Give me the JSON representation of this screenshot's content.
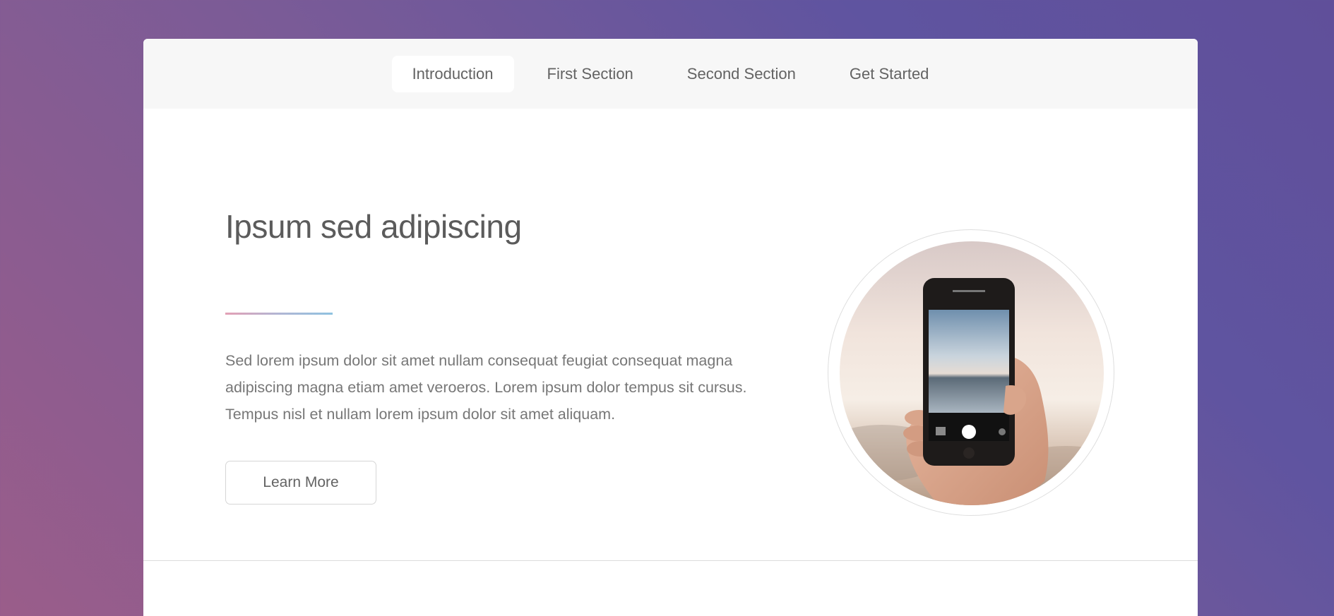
{
  "nav": {
    "items": [
      {
        "label": "Introduction",
        "active": true
      },
      {
        "label": "First Section",
        "active": false
      },
      {
        "label": "Second Section",
        "active": false
      },
      {
        "label": "Get Started",
        "active": false
      }
    ]
  },
  "intro": {
    "title": "Ipsum sed adipiscing",
    "body": "Sed lorem ipsum dolor sit amet nullam consequat feugiat consequat magna adipiscing magna etiam amet veroeros. Lorem ipsum dolor tempus sit cursus. Tempus nisl et nullam lorem ipsum dolor sit amet aliquam.",
    "button_label": "Learn More",
    "image_subject": "hand-holding-phone-camera-photo"
  },
  "colors": {
    "background_gradient_start": "#9a5d8a",
    "background_gradient_end": "#5f54a0",
    "nav_background": "#f7f7f7",
    "accent_line_start": "#e3a0b5",
    "accent_line_end": "#8fc2e0",
    "text": "#636363"
  }
}
